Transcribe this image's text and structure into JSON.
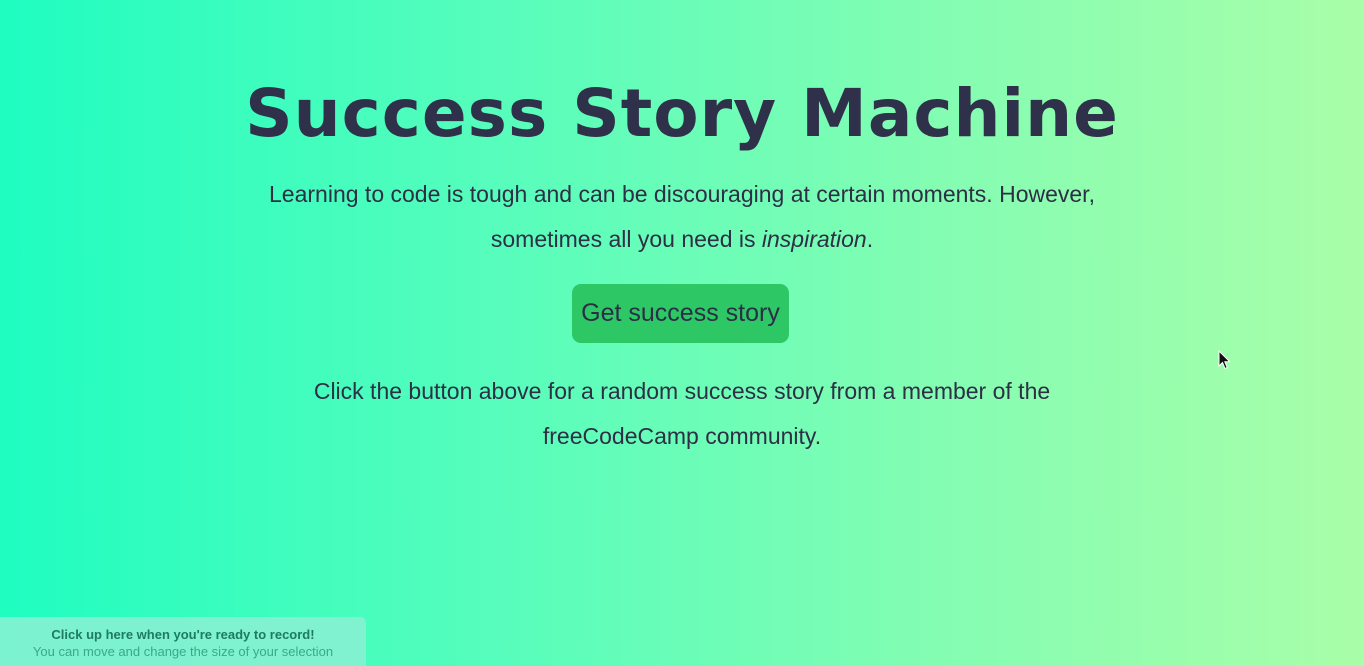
{
  "page": {
    "title": "Success Story Machine",
    "intro_text_before": "Learning to code is tough and can be discouraging at certain moments. However, sometimes all you need is ",
    "intro_emphasis": "inspiration",
    "intro_text_after": ".",
    "button_label": "Get success story",
    "hint": "Click the button above for a random success story from a member of the freeCodeCamp community."
  },
  "recorder": {
    "title": "Click up here when you're ready to record!",
    "subtitle": "You can move and change the size of your selection"
  },
  "icons": {
    "cursor": "mouse-pointer-icon"
  },
  "colors": {
    "background_start": "#1ffdc0",
    "background_end": "#a9fea8",
    "button": "#2dc766",
    "text": "#2d2f45"
  }
}
